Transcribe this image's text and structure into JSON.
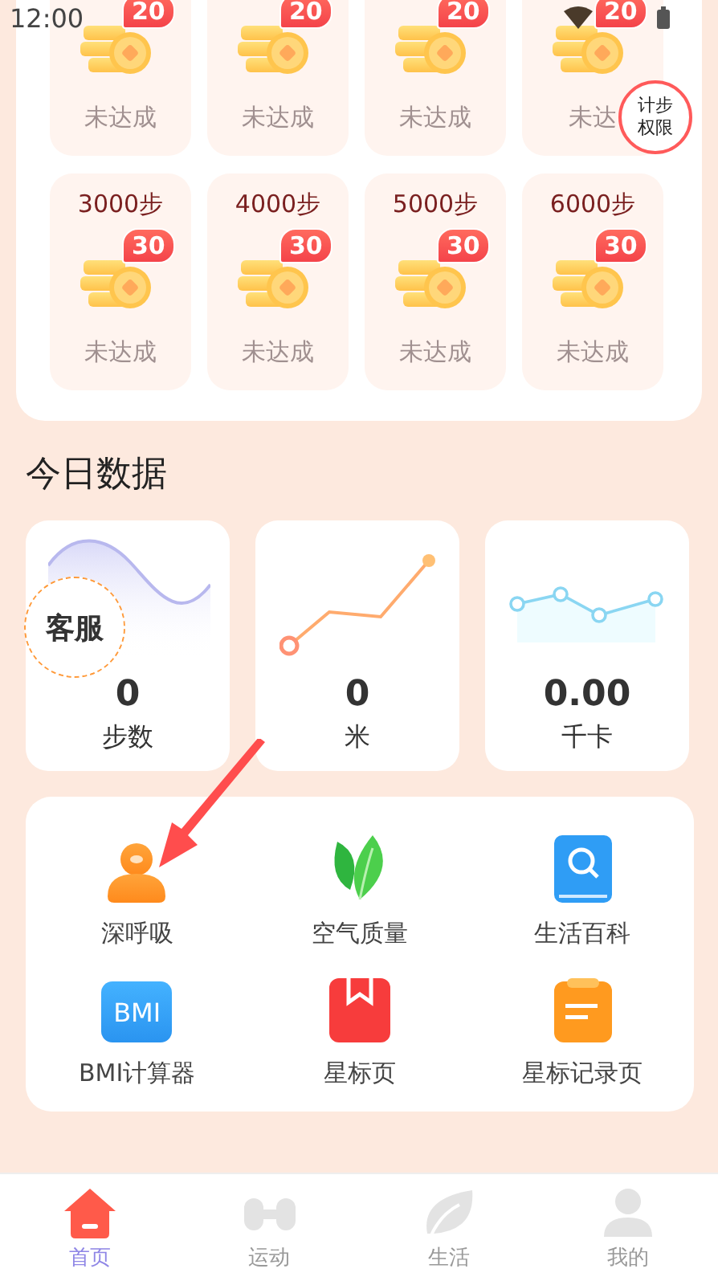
{
  "status_bar": {
    "time": "12:00"
  },
  "reward_rows": [
    {
      "tiles": [
        {
          "badge": "20",
          "status": "未达成"
        },
        {
          "badge": "20",
          "status": "未达成"
        },
        {
          "badge": "20",
          "status": "未达成"
        },
        {
          "badge": "20",
          "status": "未达"
        }
      ]
    },
    {
      "tiles": [
        {
          "steps": "3000步",
          "badge": "30",
          "status": "未达成"
        },
        {
          "steps": "4000步",
          "badge": "30",
          "status": "未达成"
        },
        {
          "steps": "5000步",
          "badge": "30",
          "status": "未达成"
        },
        {
          "steps": "6000步",
          "badge": "30",
          "status": "未达成"
        }
      ]
    }
  ],
  "today": {
    "title": "今日数据",
    "stats": [
      {
        "kind": "wave",
        "value": "0",
        "label": "步数"
      },
      {
        "kind": "rising",
        "value": "0",
        "label": "米"
      },
      {
        "kind": "points",
        "value": "0.00",
        "label": "千卡"
      }
    ]
  },
  "tools": [
    {
      "kind": "person",
      "label": "深呼吸"
    },
    {
      "kind": "leaf",
      "label": "空气质量"
    },
    {
      "kind": "book",
      "label": "生活百科"
    },
    {
      "kind": "bmi",
      "label": "BMI计算器",
      "icon_text": "BMI"
    },
    {
      "kind": "bookmark",
      "label": "星标页"
    },
    {
      "kind": "note",
      "label": "星标记录页"
    }
  ],
  "floating_buttons": [
    {
      "kind": "permission",
      "label": "计步权限"
    },
    {
      "kind": "service",
      "label": "客服"
    }
  ],
  "nav": [
    {
      "kind": "home",
      "label": "首页",
      "selected": true
    },
    {
      "kind": "dumbbell",
      "label": "运动",
      "selected": false
    },
    {
      "kind": "leaf",
      "label": "生活",
      "selected": false
    },
    {
      "kind": "person",
      "label": "我的",
      "selected": false
    }
  ]
}
